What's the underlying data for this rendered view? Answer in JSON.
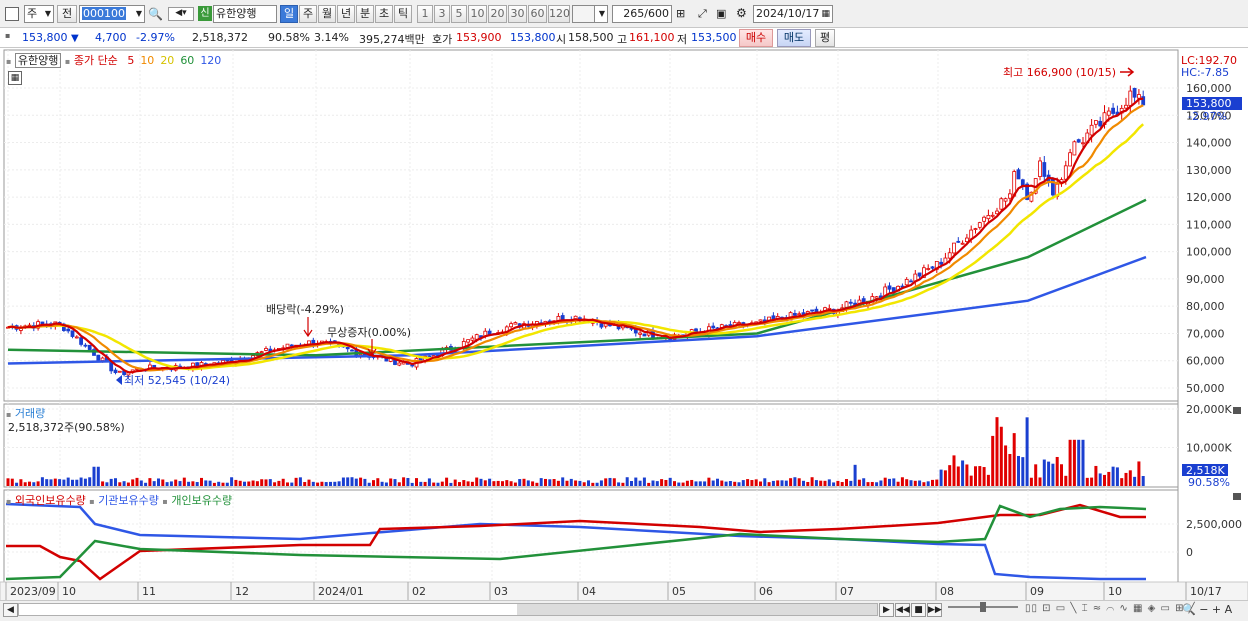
{
  "toolbar": {
    "period_selector": "주",
    "prev_label": "전",
    "code": "000100",
    "credit_badge": "신",
    "stock_name": "유한양행",
    "tabs": [
      "일",
      "주",
      "월",
      "년",
      "분",
      "초",
      "틱"
    ],
    "active_tab": "일",
    "intervals": [
      "1",
      "3",
      "5",
      "10",
      "20",
      "30",
      "60",
      "120"
    ],
    "count": "265",
    "count_total": "/600",
    "date": "2024/10/17"
  },
  "quote": {
    "price": "153,800",
    "change": "4,700",
    "change_pct": "-2.97%",
    "volume": "2,518,372",
    "volume_ratio": "90.58%",
    "turnover_pct": "3.14%",
    "amount": "395,274백만",
    "hoga_label": "호가",
    "ask": "153,900",
    "bid": "153,800",
    "open_label": "시",
    "open": "158,500",
    "high_label": "고",
    "high": "161,100",
    "low_label": "저",
    "low": "153,500",
    "buy_label": "매수",
    "sell_label": "매도",
    "eval_label": "평"
  },
  "price_panel": {
    "stock_label": "유한양행",
    "ma_label": "종가 단순",
    "ma_periods": [
      "5",
      "10",
      "20",
      "60",
      "120"
    ],
    "ma_colors": [
      "#d20000",
      "#f08a00",
      "#f2e600",
      "#22913a",
      "#2f57e6"
    ],
    "lc_label": "LC:192.70",
    "hc_label": "HC:-7.85",
    "price_tag": "153,800",
    "pct_tag": "-2.97%",
    "y_ticks": [
      "160,000",
      "150,000",
      "140,000",
      "130,000",
      "120,000",
      "110,000",
      "100,000",
      "90,000",
      "80,000",
      "70,000",
      "60,000",
      "50,000"
    ],
    "high_annot": "최고 166,900 (10/15)",
    "low_annot": "최저 52,545 (10/24)",
    "div_annot": "배당락(-4.29%)",
    "bonus_annot": "무상증자(0.00%)"
  },
  "volume_panel": {
    "title": "거래량",
    "value_label": "2,518,372주(90.58%)",
    "y_ticks": [
      "20,000K",
      "10,000K"
    ],
    "tag_value": "2,518K",
    "tag_pct": "90.58%"
  },
  "holding_panel": {
    "foreign_label": "외국인보유수량",
    "inst_label": "기관보유수량",
    "indiv_label": "개인보유수량",
    "y_ticks": [
      "2,500,000",
      "0"
    ]
  },
  "x_axis": {
    "labels": [
      "2023/09",
      "10",
      "11",
      "12",
      "2024/01",
      "02",
      "03",
      "04",
      "05",
      "06",
      "07",
      "08",
      "09",
      "10",
      "10/17"
    ]
  },
  "chart_data": {
    "type": "candlestick",
    "ylim": [
      45000,
      170000
    ],
    "close_series": {
      "x": [
        "2023/09",
        "2023/10",
        "2023/10/24",
        "2023/11",
        "2023/12",
        "2024/01",
        "2024/02",
        "2024/03",
        "2024/04",
        "2024/05",
        "2024/06",
        "2024/07",
        "2024/08",
        "2024/09",
        "2024/10/15",
        "2024/10/17"
      ],
      "values": [
        72000,
        72000,
        55000,
        58000,
        60000,
        66000,
        60000,
        70000,
        76000,
        70000,
        72000,
        80000,
        95000,
        125000,
        160000,
        153800
      ]
    },
    "ma120": {
      "x": [
        "2023/09",
        "2024/02",
        "2024/06",
        "2024/09",
        "2024/10/17"
      ],
      "values": [
        59000,
        62000,
        69000,
        82000,
        98000
      ]
    },
    "ma60": {
      "x": [
        "2023/09",
        "2024/01",
        "2024/06",
        "2024/09",
        "2024/10/17"
      ],
      "values": [
        64000,
        62000,
        70000,
        98000,
        119000
      ]
    },
    "annotations": [
      {
        "text": "최고 166,900 (10/15)",
        "value": 166900
      },
      {
        "text": "최저 52,545 (10/24)",
        "value": 52545
      }
    ]
  }
}
